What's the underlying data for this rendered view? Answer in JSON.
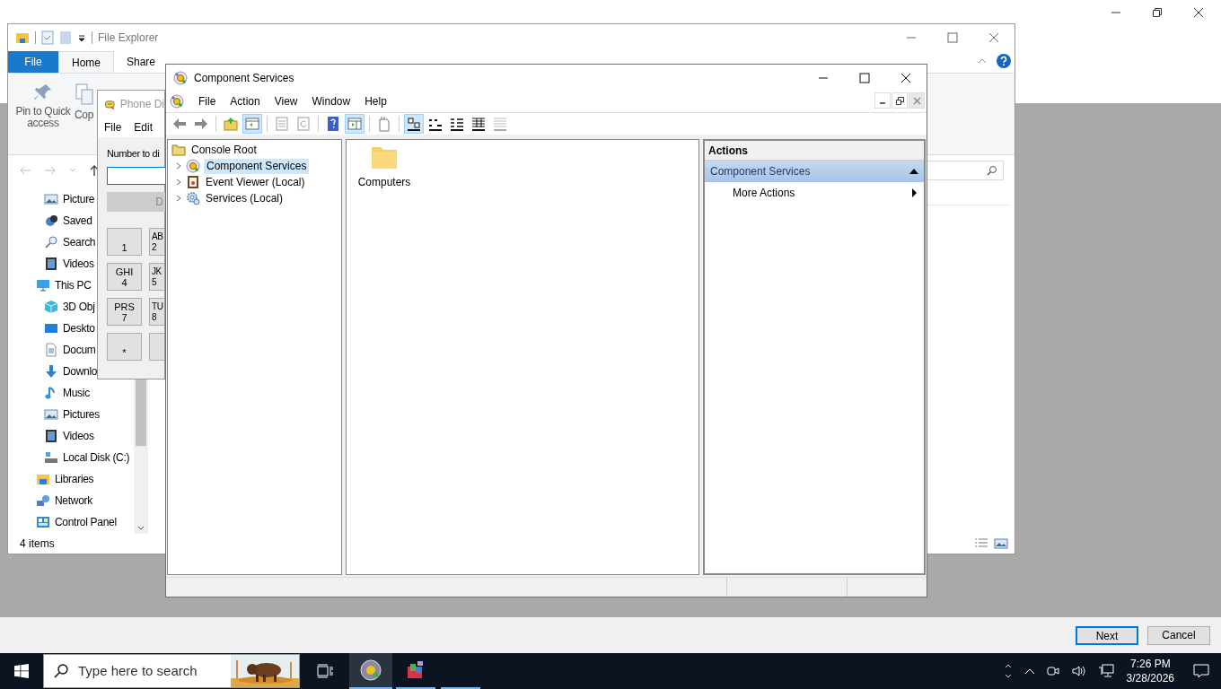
{
  "wizard": {
    "buttons": [
      {
        "label": "Next",
        "default": true
      },
      {
        "label": "Cancel",
        "default": false
      }
    ]
  },
  "file_explorer": {
    "title": "File Explorer",
    "ribbon_tabs": [
      {
        "label": "File",
        "kind": "file",
        "selected": false
      },
      {
        "label": "Home",
        "kind": "tab",
        "selected": true
      },
      {
        "label": "Share",
        "kind": "tab",
        "selected": false
      }
    ],
    "ribbon_commands": [
      {
        "label": "Pin to Quick access",
        "kind": "pin"
      },
      {
        "label": "Cop",
        "kind": "copy"
      }
    ],
    "nav_tree": [
      {
        "children": [
          {
            "label": "Picture",
            "kind": "pictures"
          },
          {
            "label": "Saved",
            "kind": "saved"
          },
          {
            "label": "Search",
            "kind": "search"
          },
          {
            "label": "Videos",
            "kind": "videos"
          }
        ]
      },
      {
        "label": "This PC",
        "kind": "pc",
        "children": [
          {
            "label": "3D Obj",
            "kind": "cube"
          },
          {
            "label": "Deskto",
            "kind": "desktop"
          },
          {
            "label": "Docum",
            "kind": "documents"
          },
          {
            "label": "Downlo",
            "kind": "downloads"
          },
          {
            "label": "Music",
            "kind": "music"
          },
          {
            "label": "Pictures",
            "kind": "pictures"
          },
          {
            "label": "Videos",
            "kind": "videos"
          },
          {
            "label": "Local Disk (C:)",
            "kind": "disk"
          }
        ]
      },
      {
        "label": "Libraries",
        "kind": "libraries"
      },
      {
        "label": "Network",
        "kind": "network"
      },
      {
        "label": "Control Panel",
        "kind": "control"
      }
    ],
    "status": "4 items"
  },
  "phone_dialer": {
    "title": "Phone Di",
    "menu": [
      "File",
      "Edit"
    ],
    "number_label": "Number to di",
    "dial_button": {
      "label": "D",
      "disabled": true
    },
    "keys": [
      {
        "digit": "1"
      },
      {
        "letters": "GHI",
        "digit": "4"
      },
      {
        "letters": "PRS",
        "digit": "7"
      },
      {
        "digit": "*"
      },
      {
        "letters": "AB",
        "digit": "2"
      },
      {
        "letters": "JK",
        "digit": "5"
      },
      {
        "letters": "TU",
        "digit": "8"
      }
    ]
  },
  "component_services": {
    "title": "Component Services",
    "menu": [
      "File",
      "Action",
      "View",
      "Window",
      "Help"
    ],
    "toolbar": [
      {
        "kind": "back",
        "pressed": false
      },
      {
        "kind": "forward",
        "pressed": false
      },
      {
        "kind": "sep"
      },
      {
        "kind": "up",
        "pressed": false
      },
      {
        "kind": "tree",
        "pressed": true
      },
      {
        "kind": "sep"
      },
      {
        "kind": "properties",
        "pressed": false
      },
      {
        "kind": "refresh",
        "pressed": false
      },
      {
        "kind": "sep"
      },
      {
        "kind": "help",
        "pressed": false
      },
      {
        "kind": "actionpane",
        "pressed": true
      },
      {
        "kind": "sep"
      },
      {
        "kind": "newwindow",
        "pressed": false
      },
      {
        "kind": "sep"
      },
      {
        "kind": "largeicons",
        "pressed": true
      },
      {
        "kind": "smallicons",
        "pressed": false
      },
      {
        "kind": "list",
        "pressed": false
      },
      {
        "kind": "details",
        "pressed": false
      },
      {
        "kind": "filtered",
        "pressed": false
      }
    ],
    "tree": [
      {
        "label": "Console Root",
        "kind": "folder",
        "selected": false,
        "children": [
          {
            "label": "Component Services",
            "kind": "complus",
            "expanded": false,
            "selected": true
          },
          {
            "label": "Event Viewer (Local)",
            "kind": "eventviewer",
            "expanded": false,
            "selected": false
          },
          {
            "label": "Services (Local)",
            "kind": "services",
            "expanded": false,
            "selected": false
          }
        ]
      }
    ],
    "items": [
      {
        "label": "Computers"
      }
    ],
    "actions": {
      "title": "Actions",
      "sections": [
        {
          "label": "Component Services",
          "expanded": true,
          "items": [
            {
              "label": "More Actions"
            }
          ]
        }
      ]
    }
  },
  "taskbar": {
    "search_placeholder": "Type here to search",
    "apps": [
      {
        "kind": "complus",
        "active": true
      },
      {
        "kind": "installer",
        "active": false
      },
      {
        "kind": "blank",
        "active": false
      }
    ]
  },
  "clock": {
    "time": "7:26 PM",
    "date": "3/28/2026"
  }
}
